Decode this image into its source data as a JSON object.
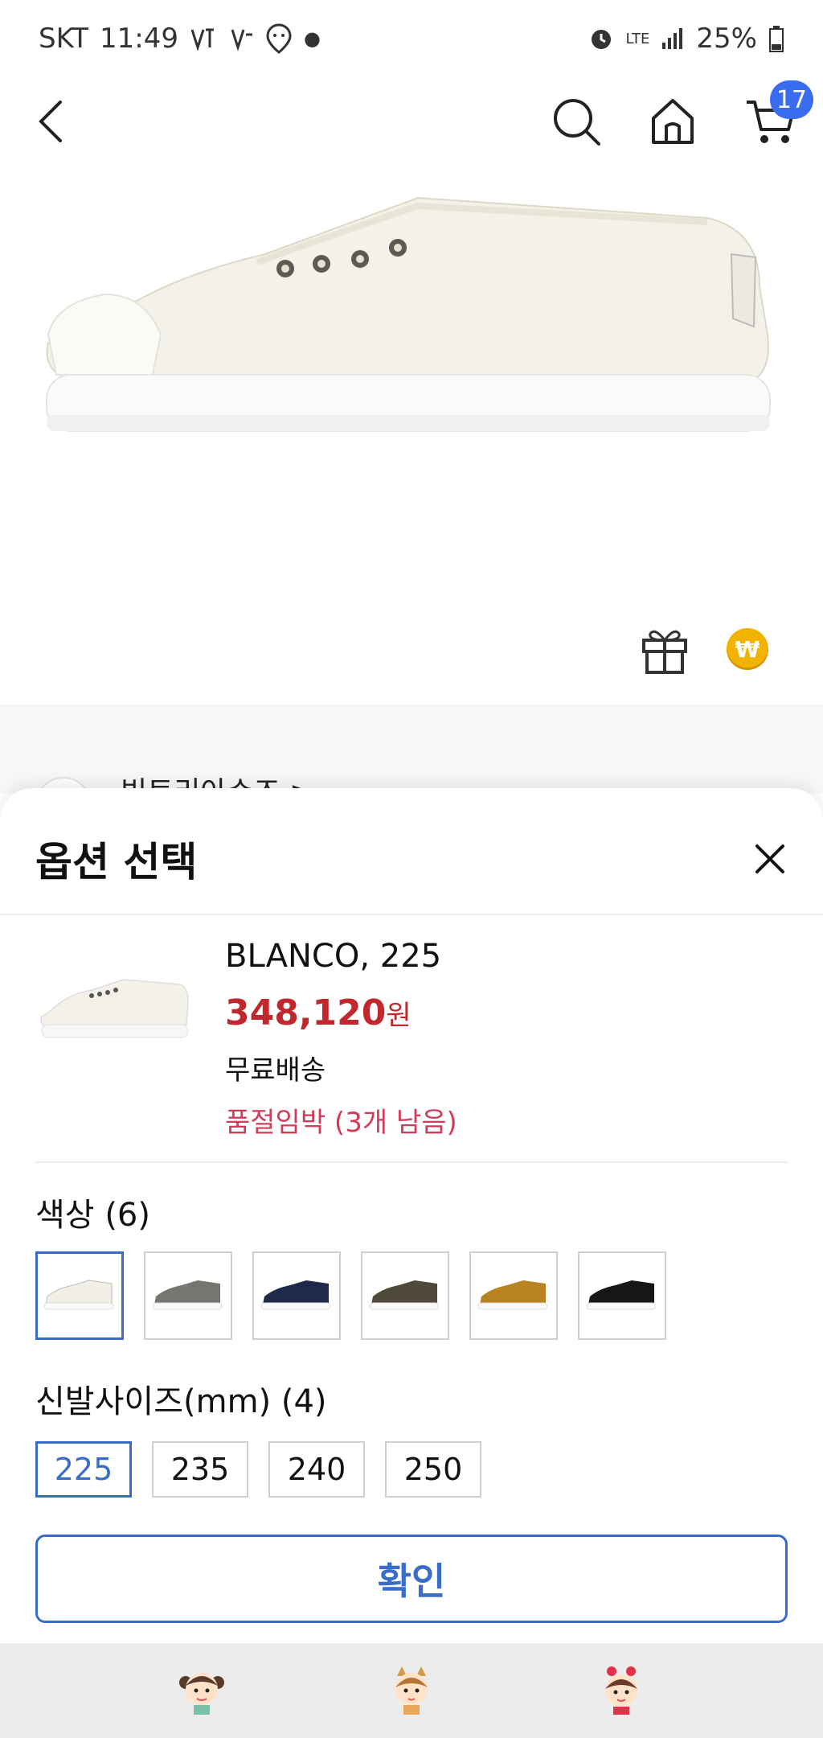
{
  "status_bar": {
    "carrier": "SKT",
    "time": "11:49",
    "battery": "25%",
    "network": "LTE"
  },
  "nav": {
    "cart_count": "17"
  },
  "peek": {
    "brand": "빅토리아슈즈 >"
  },
  "sheet": {
    "title": "옵션 선택",
    "product": {
      "name": "BLANCO, 225",
      "price": "348,120",
      "currency": "원",
      "shipping": "무료배송",
      "stock": "품절임박 (3개 남음)"
    },
    "color_label": "색상 (6)",
    "colors": [
      "#f1efe6",
      "#767571",
      "#1f2a4a",
      "#4f4a3b",
      "#b98322",
      "#161616"
    ],
    "size_label": "신발사이즈(mm) (4)",
    "sizes": [
      "225",
      "235",
      "240",
      "250"
    ],
    "selected_size": "225",
    "confirm_label": "확인"
  },
  "accent_color": "#3a6cc9",
  "price_color": "#c0282d",
  "stock_color": "#d13c5a"
}
